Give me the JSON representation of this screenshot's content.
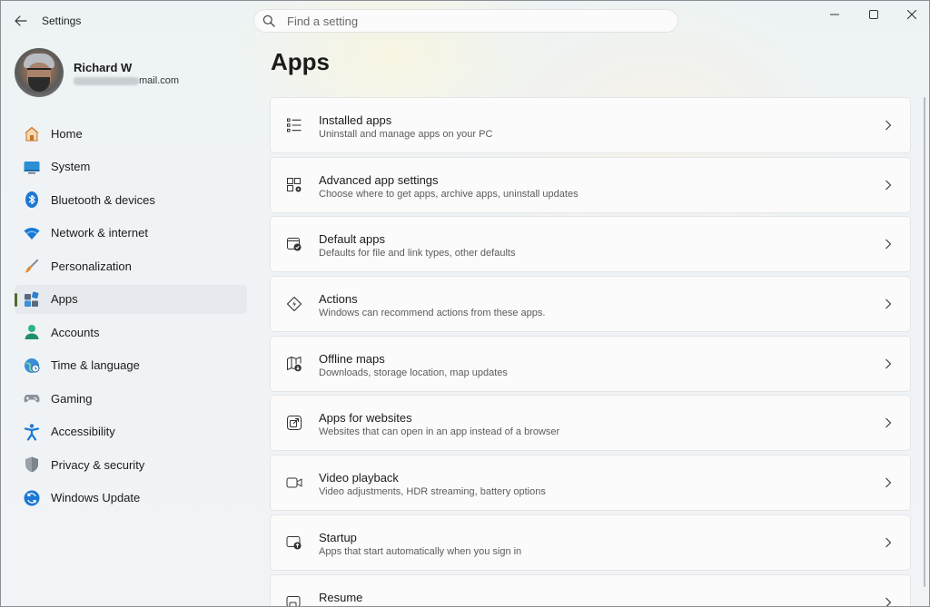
{
  "window": {
    "title": "Settings"
  },
  "search": {
    "placeholder": "Find a setting"
  },
  "user": {
    "name": "Richard W",
    "email_visible": "mail.com"
  },
  "nav": {
    "items": [
      {
        "label": "Home",
        "icon": "home-icon"
      },
      {
        "label": "System",
        "icon": "system-icon"
      },
      {
        "label": "Bluetooth & devices",
        "icon": "bluetooth-icon"
      },
      {
        "label": "Network & internet",
        "icon": "network-icon"
      },
      {
        "label": "Personalization",
        "icon": "personalization-icon"
      },
      {
        "label": "Apps",
        "icon": "apps-icon",
        "active": true
      },
      {
        "label": "Accounts",
        "icon": "accounts-icon"
      },
      {
        "label": "Time & language",
        "icon": "time-language-icon"
      },
      {
        "label": "Gaming",
        "icon": "gaming-icon"
      },
      {
        "label": "Accessibility",
        "icon": "accessibility-icon"
      },
      {
        "label": "Privacy & security",
        "icon": "shield-icon"
      },
      {
        "label": "Windows Update",
        "icon": "windows-update-icon"
      }
    ]
  },
  "main": {
    "title": "Apps",
    "cards": [
      {
        "title": "Installed apps",
        "subtitle": "Uninstall and manage apps on your PC",
        "icon": "list-icon"
      },
      {
        "title": "Advanced app settings",
        "subtitle": "Choose where to get apps, archive apps, uninstall updates",
        "icon": "app-settings-icon"
      },
      {
        "title": "Default apps",
        "subtitle": "Defaults for file and link types, other defaults",
        "icon": "default-apps-icon"
      },
      {
        "title": "Actions",
        "subtitle": "Windows can recommend actions from these apps.",
        "icon": "actions-icon"
      },
      {
        "title": "Offline maps",
        "subtitle": "Downloads, storage location, map updates",
        "icon": "map-icon"
      },
      {
        "title": "Apps for websites",
        "subtitle": "Websites that can open in an app instead of a browser",
        "icon": "open-external-icon"
      },
      {
        "title": "Video playback",
        "subtitle": "Video adjustments, HDR streaming, battery options",
        "icon": "video-icon"
      },
      {
        "title": "Startup",
        "subtitle": "Apps that start automatically when you sign in",
        "icon": "startup-icon"
      },
      {
        "title": "Resume",
        "subtitle": "",
        "icon": "resume-icon"
      }
    ]
  },
  "colors": {
    "accent": "#4f6a2e",
    "nav_active_bg": "#e6eaee",
    "card_bg": "#fbfbfb"
  }
}
